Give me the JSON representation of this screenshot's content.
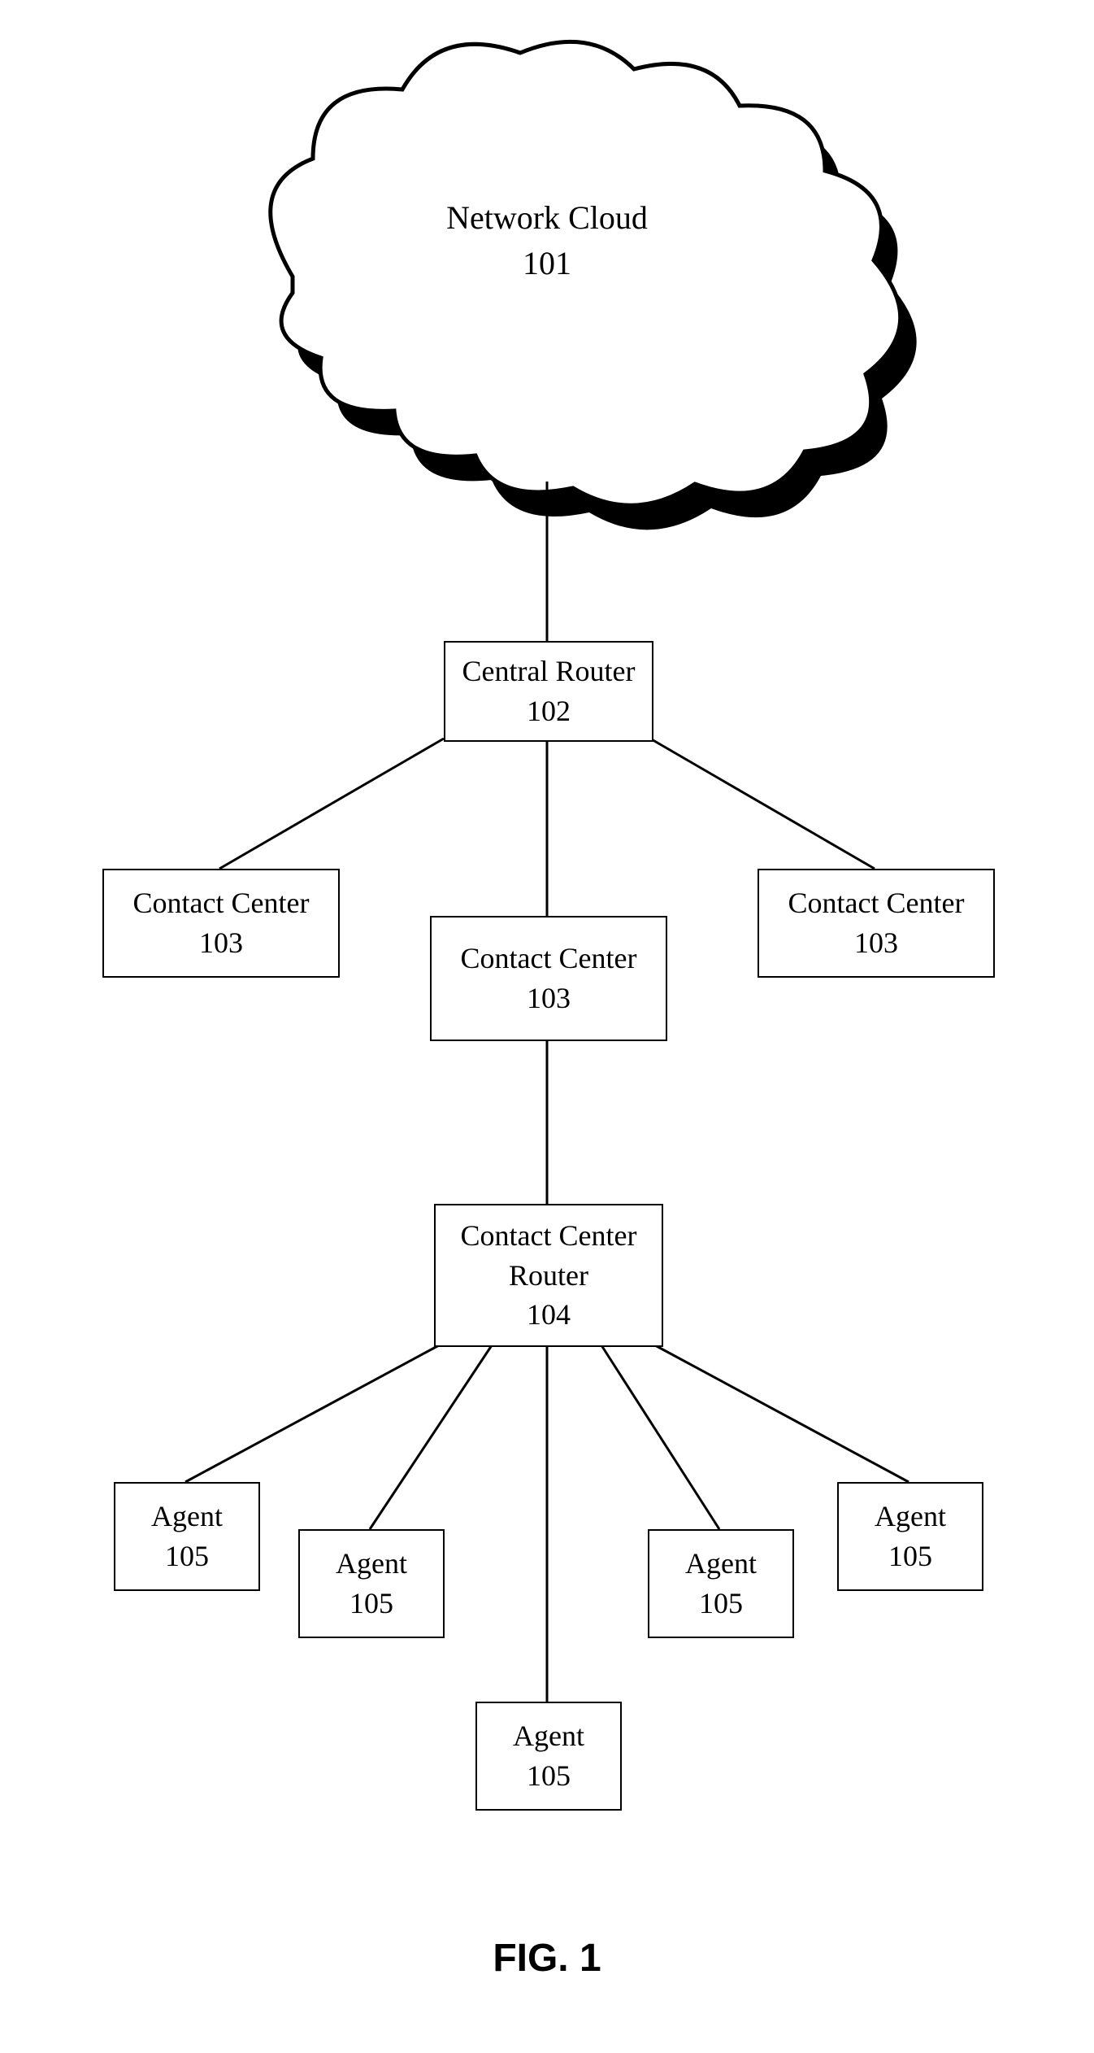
{
  "figure_label": "FIG. 1",
  "cloud": {
    "label": "Network Cloud",
    "id": "101"
  },
  "central_router": {
    "label": "Central Router",
    "id": "102"
  },
  "contact_centers": [
    {
      "label": "Contact Center",
      "id": "103"
    },
    {
      "label": "Contact Center",
      "id": "103"
    },
    {
      "label": "Contact Center",
      "id": "103"
    }
  ],
  "contact_center_router": {
    "label": "Contact Center Router",
    "id": "104"
  },
  "agents": [
    {
      "label": "Agent",
      "id": "105"
    },
    {
      "label": "Agent",
      "id": "105"
    },
    {
      "label": "Agent",
      "id": "105"
    },
    {
      "label": "Agent",
      "id": "105"
    },
    {
      "label": "Agent",
      "id": "105"
    }
  ]
}
